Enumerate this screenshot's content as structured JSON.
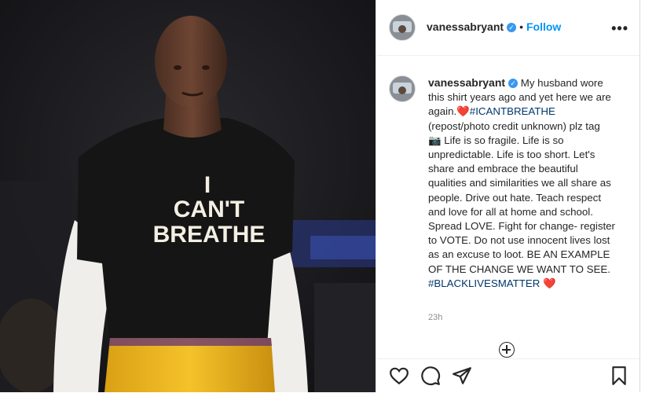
{
  "post": {
    "username": "vanessabryant",
    "follow_label": "Follow",
    "separator": "•",
    "more_label": "•••",
    "verified_mark": "✓",
    "caption": {
      "text1": "My husband wore this shirt years ago and yet here we are again.",
      "heart1": "❤️",
      "hashtag1": "#ICANTBREATHE",
      "text2": "(repost/photo credit unknown) plz tag",
      "camera": "📷",
      "text3": "Life is so fragile. Life is so unpredictable. Life is too short. Let's share and embrace the beautiful qualities and similarities we all share as people. Drive out hate. Teach respect and love for all at home and school. Spread LOVE. Fight for change- register to VOTE. Do not use innocent lives lost as an excuse to loot. BE AN EXAMPLE OF THE CHANGE WE WANT TO SEE.",
      "hashtag2": "#BLACKLIVESMATTER",
      "heart2": "❤️"
    },
    "timestamp": "23h"
  },
  "photo": {
    "shirt_text_line1": "I",
    "shirt_text_line2": "CAN'T",
    "shirt_text_line3": "BREATHE"
  },
  "icons": [
    "heart-icon",
    "comment-icon",
    "share-icon",
    "bookmark-icon",
    "more-icon",
    "add-icon",
    "verified-icon"
  ],
  "colors": {
    "follow": "#0095f6",
    "verified": "#3897f0",
    "hashtag": "#00376b",
    "heart": "#ed4956",
    "jersey": "#f2b51c"
  }
}
